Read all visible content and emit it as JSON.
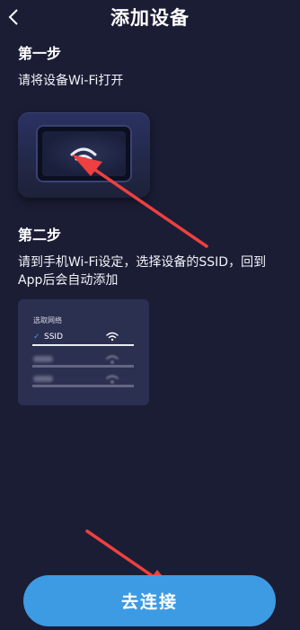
{
  "header": {
    "title": "添加设备",
    "back_icon": "chevron-left-icon"
  },
  "step1": {
    "title": "第一步",
    "desc": "请将设备Wi-Fi打开"
  },
  "step2": {
    "title": "第二步",
    "desc_line1": "请到手机Wi-Fi设定，选择设备的SSID，回到",
    "desc_line2": "App后会自动添加"
  },
  "wifi_illustration": {
    "title": "选取网络",
    "selected_ssid": "SSID",
    "other_networks": [
      "SSID",
      "SSID"
    ]
  },
  "actions": {
    "connect_label": "去连接"
  },
  "colors": {
    "background": "#1b1d35",
    "button": "#3d9be3",
    "arrow": "#ee4040",
    "check": "#4a9cf0"
  }
}
